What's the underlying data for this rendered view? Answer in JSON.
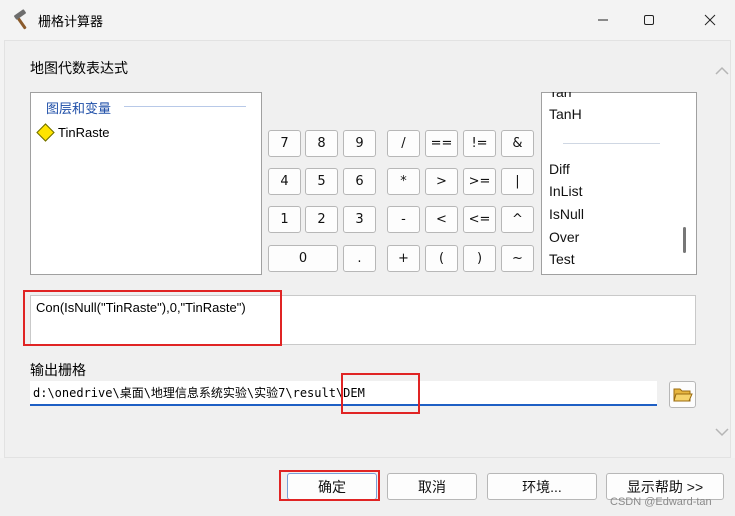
{
  "window": {
    "title": "栅格计算器",
    "icons": {
      "app": "hammer-icon",
      "minimize": "minimize-icon",
      "maximize": "maximize-icon",
      "close": "close-icon"
    }
  },
  "expression_section": {
    "label": "地图代数表达式"
  },
  "layers": {
    "heading": "图层和变量",
    "items": [
      "TinRaste"
    ]
  },
  "keypad": {
    "keys": [
      "7",
      "8",
      "9",
      "/",
      "==",
      "!=",
      "&",
      "4",
      "5",
      "6",
      "*",
      ">",
      ">=",
      "|",
      "1",
      "2",
      "3",
      "-",
      "<",
      "<=",
      "^",
      "0",
      ".",
      "+",
      "(",
      ")",
      "~"
    ]
  },
  "functions": {
    "items_top": [
      "Tan",
      "TanH"
    ],
    "items_bottom": [
      "Diff",
      "InList",
      "IsNull",
      "Over",
      "Test"
    ]
  },
  "expression": {
    "value": "Con(IsNull(\"TinRaste\"),0,\"TinRaste\")"
  },
  "output": {
    "label": "输出栅格",
    "value": "d:\\onedrive\\桌面\\地理信息系统实验\\实验7\\result\\DEM",
    "browse_icon": "folder-open-icon"
  },
  "buttons": {
    "ok": "确定",
    "cancel": "取消",
    "environments": "环境...",
    "show_help": "显示帮助 >>"
  },
  "watermark": "CSDN @Edward-tan",
  "colors": {
    "highlight": "#e02424",
    "input_underline": "#1e5fc4",
    "layer_heading": "#1f4fa8"
  }
}
